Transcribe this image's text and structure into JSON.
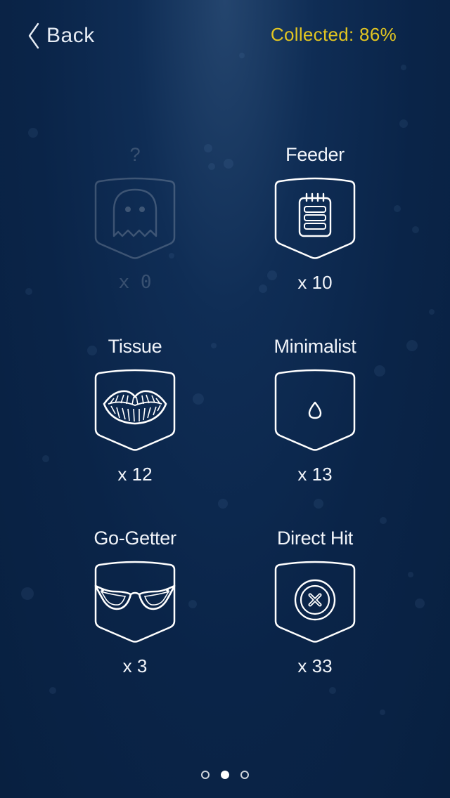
{
  "header": {
    "back_label": "Back",
    "collected_text": "Collected: 86%"
  },
  "badges": [
    {
      "name": "?",
      "count": "x 0",
      "icon": "ghost-icon",
      "locked": true
    },
    {
      "name": "Feeder",
      "count": "x 10",
      "icon": "notepad-icon",
      "locked": false
    },
    {
      "name": "Tissue",
      "count": "x 12",
      "icon": "lips-icon",
      "locked": false
    },
    {
      "name": "Minimalist",
      "count": "x 13",
      "icon": "drop-icon",
      "locked": false
    },
    {
      "name": "Go-Getter",
      "count": "x 3",
      "icon": "glasses-icon",
      "locked": false
    },
    {
      "name": "Direct Hit",
      "count": "x 33",
      "icon": "button-x-icon",
      "locked": false
    }
  ],
  "pager": {
    "total": 3,
    "current": 2
  },
  "colors": {
    "background": "#0a2448",
    "accent_yellow": "#e2c521",
    "text": "#f2f5fa"
  }
}
